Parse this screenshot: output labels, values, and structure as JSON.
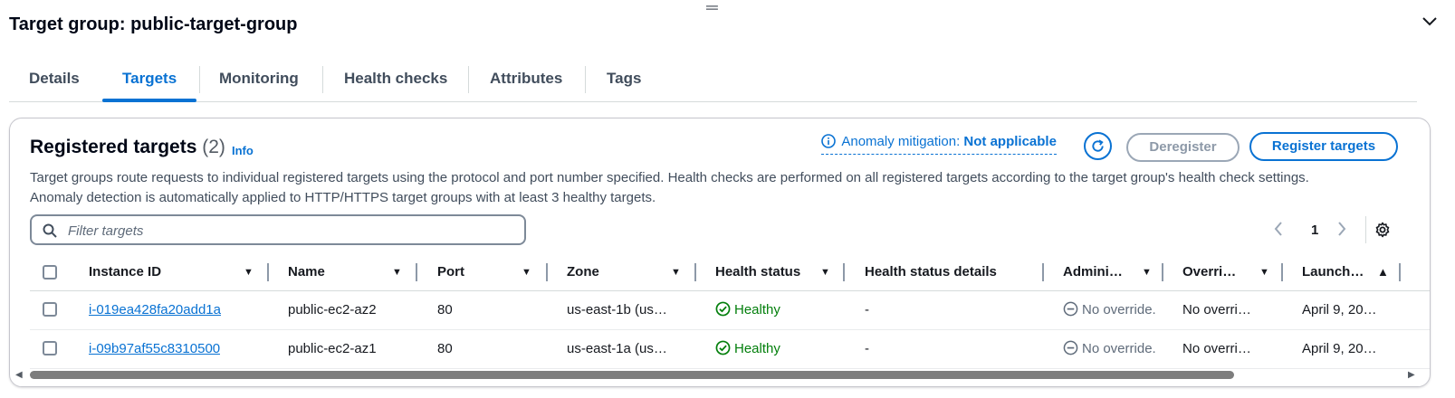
{
  "header": {
    "title": "Target group: public-target-group"
  },
  "tabs": [
    {
      "label": "Details"
    },
    {
      "label": "Targets"
    },
    {
      "label": "Monitoring"
    },
    {
      "label": "Health checks"
    },
    {
      "label": "Attributes"
    },
    {
      "label": "Tags"
    }
  ],
  "active_tab": "Targets",
  "panel": {
    "title": "Registered targets",
    "count": "(2)",
    "info": "Info",
    "anomaly_label": "Anomaly mitigation:",
    "anomaly_value": "Not applicable",
    "deregister": "Deregister",
    "register": "Register targets",
    "description_line1": "Target groups route requests to individual registered targets using the protocol and port number specified. Health checks are performed on all registered targets according to the target group's health check settings.",
    "description_line2": "Anomaly detection is automatically applied to HTTP/HTTPS target groups with at least 3 healthy targets."
  },
  "filter": {
    "placeholder": "Filter targets",
    "value": ""
  },
  "pagination": {
    "page": "1"
  },
  "table": {
    "columns": [
      "Instance ID",
      "Name",
      "Port",
      "Zone",
      "Health status",
      "Health status details",
      "Admini…",
      "Overri…",
      "Launch…"
    ],
    "sorted_column": "Launch…",
    "sort_direction": "ascending",
    "rows": [
      {
        "instance_id": "i-019ea428fa20add1a",
        "name": "public-ec2-az2",
        "port": "80",
        "zone": "us-east-1b (us…",
        "health": "Healthy",
        "health_details": "-",
        "admin": "No override.",
        "override": "No overri…",
        "launch": "April 9, 20…"
      },
      {
        "instance_id": "i-09b97af55c8310500",
        "name": "public-ec2-az1",
        "port": "80",
        "zone": "us-east-1a (us…",
        "health": "Healthy",
        "health_details": "-",
        "admin": "No override.",
        "override": "No overri…",
        "launch": "April 9, 20…"
      }
    ]
  },
  "colors": {
    "accent": "#0972d3",
    "healthy": "#037f0c",
    "text": "#16191f"
  },
  "icons": [
    "drag-handle-icon",
    "chevron-down-icon",
    "info-icon",
    "refresh-icon",
    "search-icon",
    "angle-left-icon",
    "angle-right-icon",
    "settings-icon",
    "sort-icon",
    "sort-ascending-icon",
    "status-positive-icon",
    "status-stopped-icon"
  ]
}
